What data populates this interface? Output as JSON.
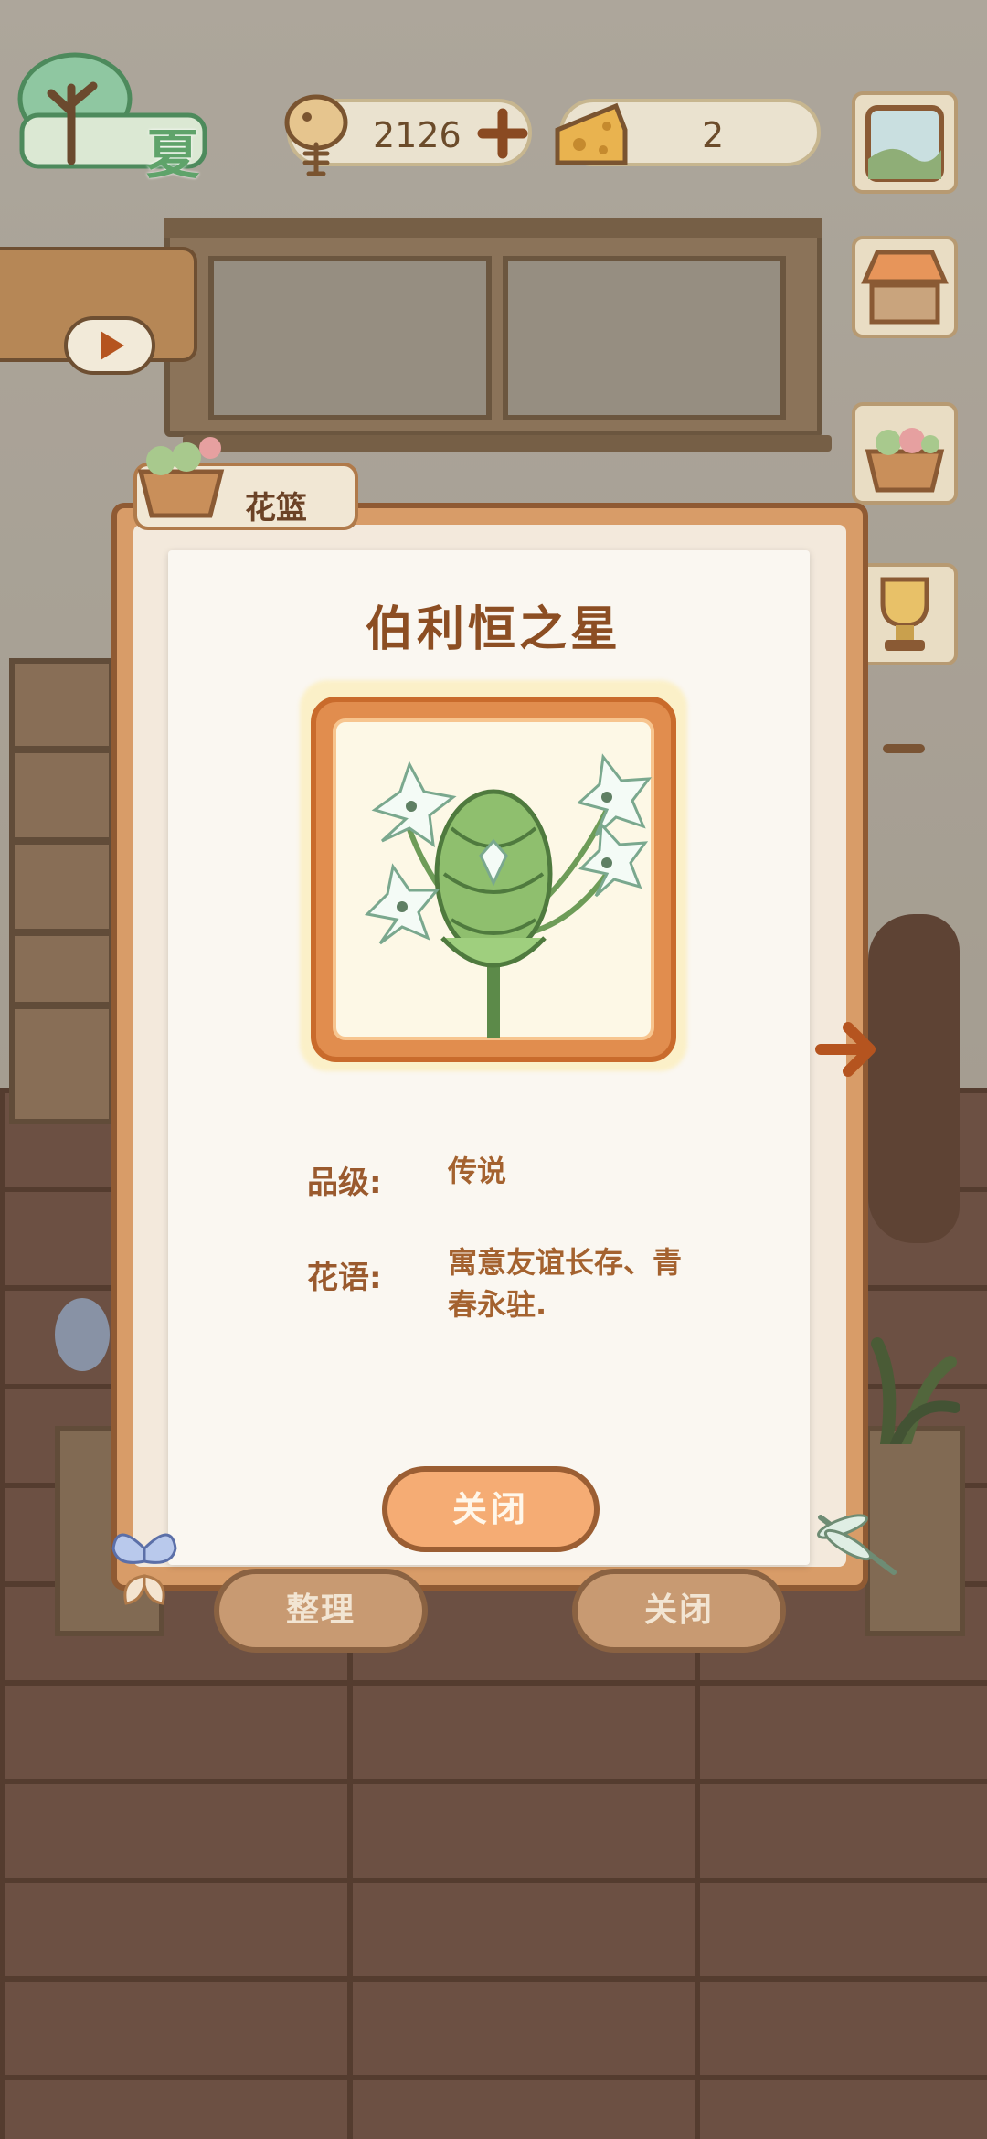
{
  "hud": {
    "season_label": "夏",
    "fish_count": "2126",
    "cheese_count": "2"
  },
  "dialog": {
    "tab_label": "花篮",
    "flower_name": "伯利恒之星",
    "grade_label": "品级:",
    "grade_value": "传说",
    "language_label": "花语:",
    "language_value_line1": "寓意友谊长存、青",
    "language_value_line2": "春永驻.",
    "close_button": "关闭"
  },
  "bottom_bar": {
    "organize_button": "整理",
    "close_button": "关闭"
  },
  "colors": {
    "accent_orange": "#f5ac74",
    "title_brown": "#8c4e23",
    "frame_brown": "#8f5a33"
  },
  "icons": [
    "tree-icon",
    "fishbone-icon",
    "plus-icon",
    "cheese-icon",
    "window-icon",
    "shop-stall-icon",
    "flower-basket-icon",
    "trophy-icon",
    "play-icon",
    "arrow-right-icon",
    "butterfly-icon",
    "dragonfly-icon"
  ]
}
